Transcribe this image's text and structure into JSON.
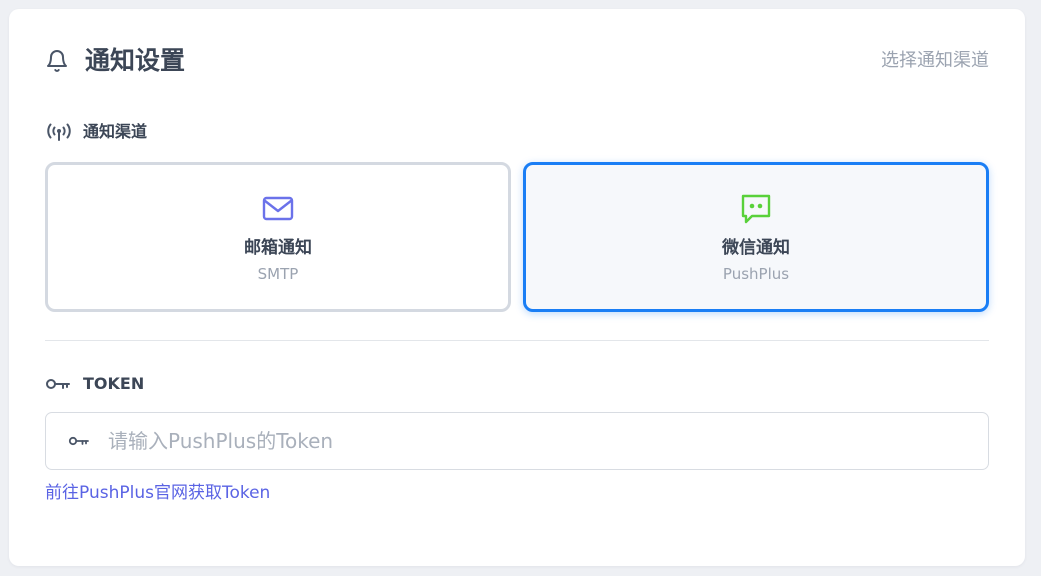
{
  "header": {
    "title": "通知设置",
    "hint": "选择通知渠道"
  },
  "channels_section": {
    "label": "通知渠道",
    "items": [
      {
        "name": "邮箱通知",
        "sub": "SMTP",
        "selected": false,
        "icon": "mail-icon",
        "color": "#6b72ea"
      },
      {
        "name": "微信通知",
        "sub": "PushPlus",
        "selected": true,
        "icon": "chat-icon",
        "color": "#59d13a"
      }
    ]
  },
  "token_section": {
    "label": "TOKEN",
    "placeholder": "请输入PushPlus的Token",
    "value": "",
    "link_text": "前往PushPlus官网获取Token"
  },
  "colors": {
    "accent": "#1a7ef5",
    "link": "#5a63e4",
    "text": "#3c4656",
    "muted": "#9ba3b0"
  }
}
